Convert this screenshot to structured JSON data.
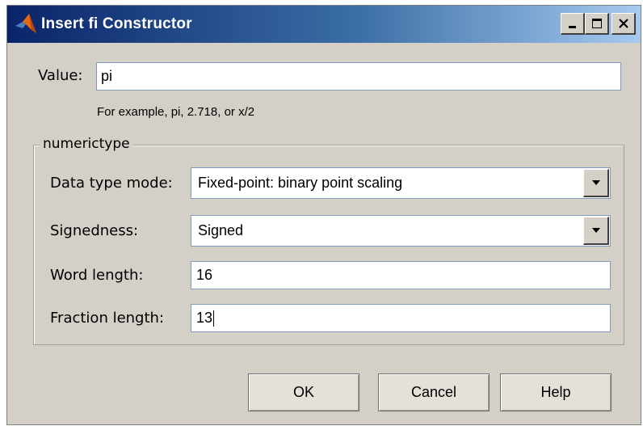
{
  "window": {
    "title": "Insert fi Constructor"
  },
  "value": {
    "label": "Value:",
    "input": "pi",
    "hint": "For example, pi, 2.718, or x/2"
  },
  "numerictype": {
    "group_label": "numerictype",
    "data_type_mode": {
      "label": "Data type mode:",
      "selected": "Fixed-point: binary point scaling"
    },
    "signedness": {
      "label": "Signedness:",
      "selected": "Signed"
    },
    "word_length": {
      "label": "Word length:",
      "value": "16"
    },
    "fraction_length": {
      "label": "Fraction length:",
      "value": "13"
    }
  },
  "buttons": {
    "ok": "OK",
    "cancel": "Cancel",
    "help": "Help"
  },
  "colors": {
    "titlebar_start": "#0a246a",
    "titlebar_end": "#a6caf0",
    "dialog_bg": "#d4d0c8"
  },
  "icons": {
    "app": "matlab-logo-icon",
    "minimize": "minimize-icon",
    "maximize": "maximize-icon",
    "close": "close-icon",
    "dropdown": "chevron-down-icon"
  }
}
